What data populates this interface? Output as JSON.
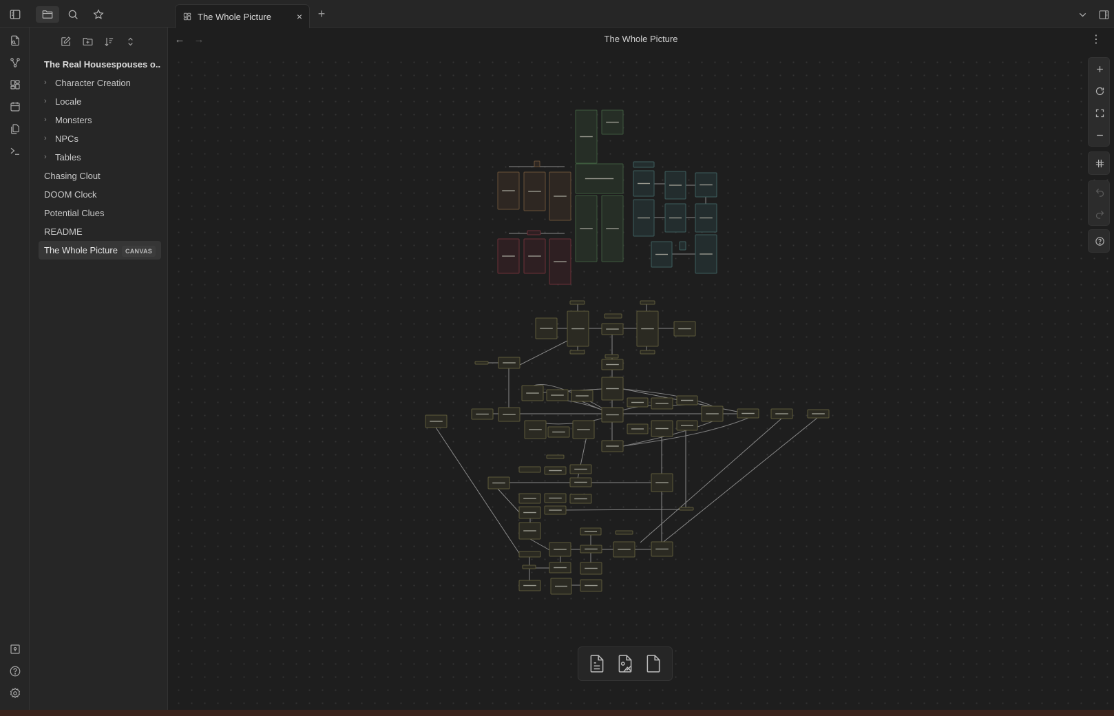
{
  "ribbon": {
    "top_icons": [
      "search-in-file-icon",
      "graph-view-icon",
      "canvas-icon",
      "calendar-icon",
      "copy-icon",
      "terminal-icon"
    ],
    "bottom_icons": [
      "vault-icon",
      "help-icon",
      "settings-icon"
    ]
  },
  "sidebar": {
    "top_tabs": [
      "sidebar-toggle-icon",
      "files-icon",
      "search-icon",
      "bookmarks-icon"
    ],
    "actions": [
      "new-note-icon",
      "new-folder-icon",
      "sort-icon",
      "collapse-icon"
    ],
    "vault_name": "The Real Housespouses o...",
    "folders": [
      {
        "label": "Character Creation"
      },
      {
        "label": "Locale"
      },
      {
        "label": "Monsters"
      },
      {
        "label": "NPCs"
      },
      {
        "label": "Tables"
      }
    ],
    "files": [
      {
        "label": "Chasing Clout"
      },
      {
        "label": "DOOM Clock"
      },
      {
        "label": "Potential Clues"
      },
      {
        "label": "README"
      }
    ],
    "active_file": {
      "label": "The Whole Picture",
      "badge": "CANVAS"
    }
  },
  "tabs": {
    "active": {
      "label": "The Whole Picture",
      "close": "×"
    },
    "new_tab": "+"
  },
  "view": {
    "title": "The Whole Picture",
    "back": "←",
    "forward": "→",
    "more": "⋮"
  },
  "canvas_controls": {
    "zoom": [
      "zoom-in",
      "reset-zoom",
      "zoom-to-fit",
      "zoom-out"
    ],
    "snap": "snap-to-grid",
    "history": [
      "undo",
      "redo"
    ],
    "help": "help"
  },
  "card_menu": [
    "add-card",
    "add-note-from-vault",
    "add-media"
  ],
  "colors": {
    "accent_background": "#1e1e1e",
    "node_brown": "#2e2722",
    "node_brown_border": "#6b5238",
    "node_red": "#2e1f22",
    "node_red_border": "#6e3038",
    "node_green": "#262e26",
    "node_green_border": "#3d5a3d",
    "node_teal": "#232d2e",
    "node_teal_border": "#3e5e5e",
    "node_olive": "#2b2a22",
    "node_olive_border": "#5e5a3a"
  }
}
